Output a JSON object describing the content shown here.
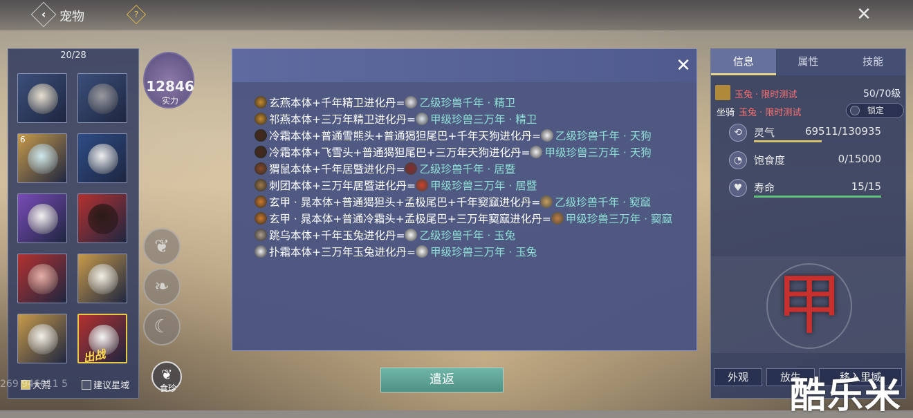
{
  "header": {
    "title": "宠物",
    "help": "?",
    "back": "‹",
    "close": "✕"
  },
  "left": {
    "count": "20/28",
    "slots": [
      {
        "badge": "",
        "color": "#3b4f7a",
        "face": "#e8e0d0"
      },
      {
        "badge": "",
        "color": "#3b4f7a",
        "face": "#9a9aa0"
      },
      {
        "badge": "6",
        "color": "#c79a4a",
        "face": "#cfe8ee"
      },
      {
        "badge": "",
        "color": "#2d4c86",
        "face": "#eeeeee"
      },
      {
        "badge": "",
        "color": "#7a4bb8",
        "face": "#f4f2f0"
      },
      {
        "badge": "",
        "color": "#b3312f",
        "face": "#2a1a18"
      },
      {
        "badge": "",
        "color": "#b3312f",
        "face": "#e6b0a8"
      },
      {
        "badge": "",
        "color": "#c79a4a",
        "face": "#f1efe6"
      },
      {
        "badge": "",
        "color": "#c79a4a",
        "face": "#f2f0ea"
      },
      {
        "badge": "",
        "color": "#b3312f",
        "face": "#f6f6f6",
        "deploy": "出战"
      }
    ],
    "checks": [
      {
        "label": "大荒",
        "checked": true
      },
      {
        "label": "建议星域",
        "checked": false
      }
    ],
    "id_text": "269  946011  5"
  },
  "power": {
    "value": "12846",
    "label": "实力"
  },
  "food": {
    "icon": "❦",
    "label": "食珍"
  },
  "popup": {
    "recipes": [
      {
        "icon_color": "#c88a2a",
        "text": "玄燕本体+千年精卫进化丹=",
        "res_color": "#e8e6f0",
        "result": "乙级珍兽千年 · 精卫"
      },
      {
        "icon_color": "#c88a2a",
        "text": "祁燕本体+三万年精卫进化丹=",
        "res_color": "#dfe6f0",
        "result": "甲级珍兽三万年 · 精卫"
      },
      {
        "icon_color": "#4a2a1a",
        "text": "冷霜本体+普通雪熊头+普通猲狚尾巴+千年天狗进化丹=",
        "res_color": "#f0f0f0",
        "result": "乙级珍兽千年 · 天狗"
      },
      {
        "icon_color": "#4a2a1a",
        "text": "冷霜本体+飞雪头+普通猲狚尾巴+三万年天狗进化丹=",
        "res_color": "#f0f0f0",
        "result": "甲级珍兽三万年 · 天狗"
      },
      {
        "icon_color": "#8a4a2a",
        "text": "猬鼠本体+千年居暨进化丹=",
        "res_color": "#8a2a2a",
        "result": "乙级珍兽千年 · 居暨"
      },
      {
        "icon_color": "#a07a4a",
        "text": "刺团本体+三万年居暨进化丹=",
        "res_color": "#d0402a",
        "result": "甲级珍兽三万年 · 居暨"
      },
      {
        "icon_color": "#d07a2a",
        "text": "玄甲 · 晁本体+普通猲狚头+孟极尾巴+千年窫窳进化丹=",
        "res_color": "#c8a060",
        "result": "乙级珍兽千年 · 窫窳"
      },
      {
        "icon_color": "#d07a2a",
        "text": "玄甲 · 晁本体+普通冷霜头+孟极尾巴+三万年窫窳进化丹=",
        "res_color": "#c08040",
        "result": "甲级珍兽三万年 · 窫窳"
      },
      {
        "icon_color": "#b0a090",
        "text": "跳乌本体+千年玉兔进化丹=",
        "res_color": "#f6f6f6",
        "result": "乙级珍兽千年 · 玉兔"
      },
      {
        "icon_color": "#f0f0f0",
        "text": "扑霜本体+三万年玉兔进化丹=",
        "res_color": "#f6f6f6",
        "result": "甲级珍兽三万年 · 玉兔"
      }
    ]
  },
  "release_btn": "遣返",
  "right": {
    "tabs": [
      "信息",
      "属性",
      "技能"
    ],
    "pet_name": "玉兔 · 限时测试",
    "level": "50/70级",
    "mount_label": "坐骑",
    "mount_name": "玉兔 · 限时测试",
    "lock_label": "锁定",
    "stats": [
      {
        "name": "灵气",
        "value": "69511/130935",
        "icon": "⟲",
        "fill_pct": 53,
        "color": "#d9c36a"
      },
      {
        "name": "饱食度",
        "value": "0/15000",
        "icon": "◔",
        "fill_pct": 0,
        "color": "#d9c36a"
      },
      {
        "name": "寿命",
        "value": "15/15",
        "icon": "♥",
        "fill_pct": 100,
        "color": "#5fc47a"
      }
    ],
    "emblem": "甲",
    "buttons": [
      "外观",
      "放生",
      "移入里域"
    ]
  },
  "watermark": "酷乐米"
}
